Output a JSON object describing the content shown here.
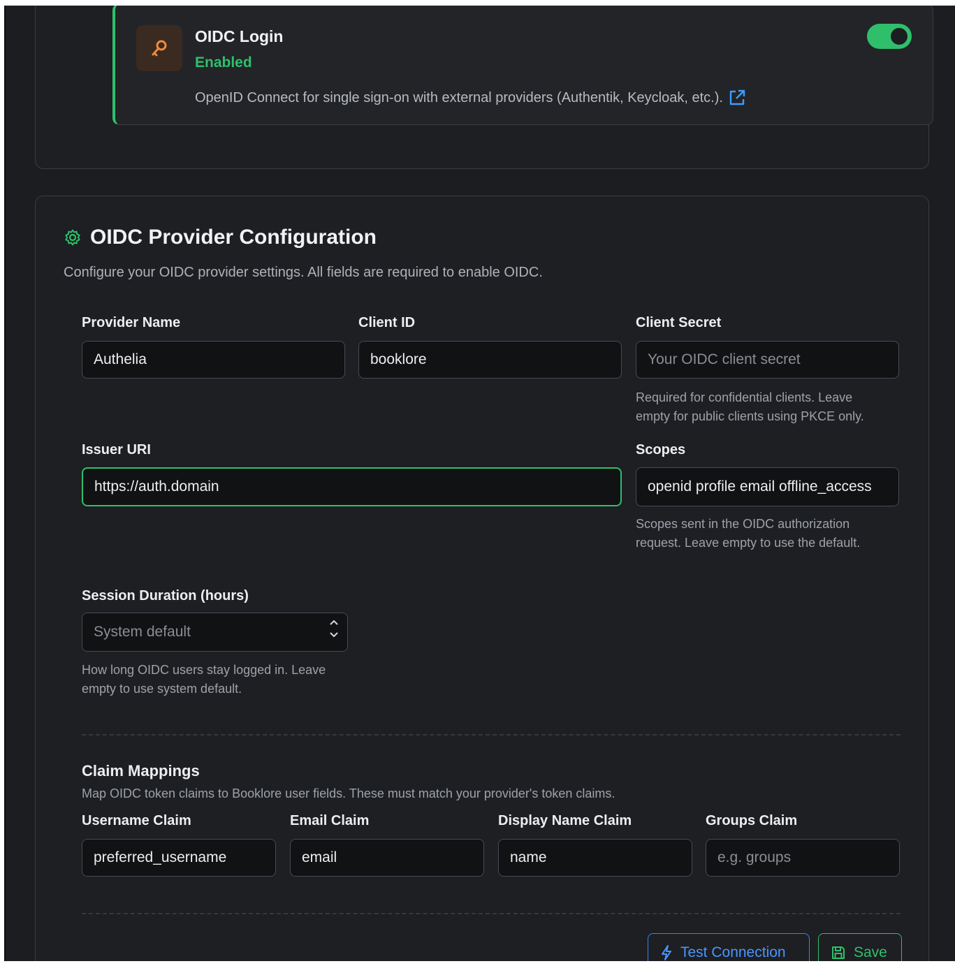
{
  "feature": {
    "title": "OIDC Login",
    "status": "Enabled",
    "description": "OpenID Connect for single sign-on with external providers (Authentik, Keycloak, etc.).",
    "enabled": true
  },
  "config": {
    "title": "OIDC Provider Configuration",
    "subtitle": "Configure your OIDC provider settings. All fields are required to enable OIDC.",
    "fields": {
      "provider_name": {
        "label": "Provider Name",
        "value": "Authelia"
      },
      "client_id": {
        "label": "Client ID",
        "value": "booklore"
      },
      "client_secret": {
        "label": "Client Secret",
        "value": "",
        "placeholder": "Your OIDC client secret",
        "hint": "Required for confidential clients. Leave empty for public clients using PKCE only."
      },
      "issuer_uri": {
        "label": "Issuer URI",
        "value": "https://auth.domain"
      },
      "scopes": {
        "label": "Scopes",
        "value": "openid profile email offline_access",
        "hint": "Scopes sent in the OIDC authorization request. Leave empty to use the default."
      },
      "session_duration": {
        "label": "Session Duration (hours)",
        "value": "",
        "placeholder": "System default",
        "hint": "How long OIDC users stay logged in. Leave empty to use system default."
      }
    },
    "claims": {
      "title": "Claim Mappings",
      "subtitle": "Map OIDC token claims to Booklore user fields. These must match your provider's token claims.",
      "username": {
        "label": "Username Claim",
        "value": "preferred_username"
      },
      "email": {
        "label": "Email Claim",
        "value": "email"
      },
      "display_name": {
        "label": "Display Name Claim",
        "value": "name"
      },
      "groups": {
        "label": "Groups Claim",
        "value": "",
        "placeholder": "e.g. groups"
      }
    },
    "actions": {
      "test_label": "Test Connection",
      "save_label": "Save"
    }
  },
  "colors": {
    "accent_green": "#2fbf6b",
    "accent_blue": "#3b82f6",
    "key_icon": "#f08a3c"
  },
  "icons": {
    "feature": "key-icon",
    "external": "external-link-icon",
    "section": "gear-icon",
    "test": "lightning-icon",
    "save": "save-icon"
  }
}
